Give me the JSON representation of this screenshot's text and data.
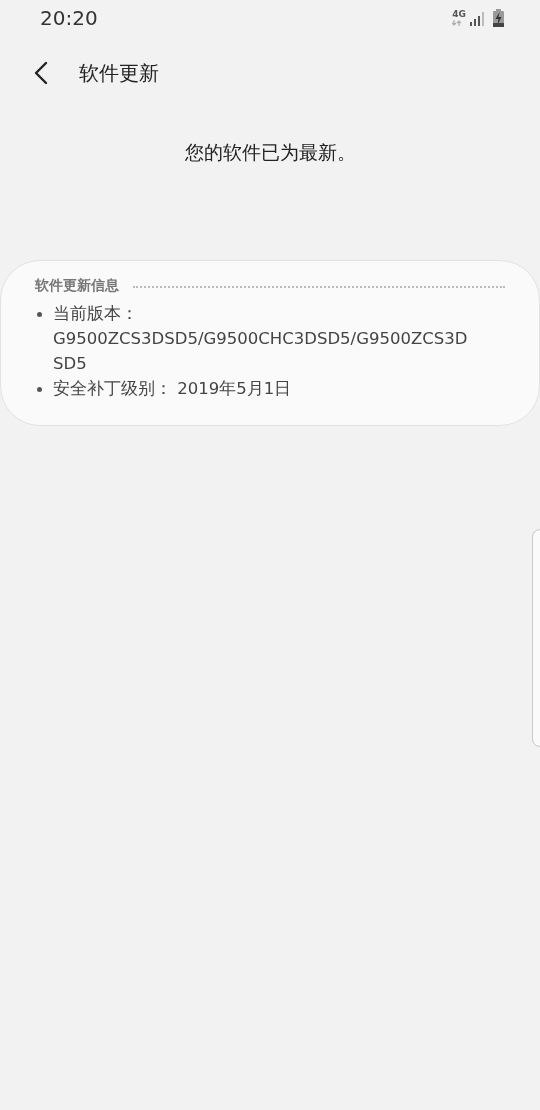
{
  "status_bar": {
    "time": "20:20",
    "network": "4G"
  },
  "header": {
    "title": "软件更新"
  },
  "message": "您的软件已为最新。",
  "info_card": {
    "heading": "软件更新信息",
    "items": [
      {
        "text": "当前版本：G9500ZCS3DSD5/G9500CHC3DSD5/G9500ZCS3DSD5"
      },
      {
        "text": "安全补丁级别： 2019年5月1日"
      }
    ]
  }
}
